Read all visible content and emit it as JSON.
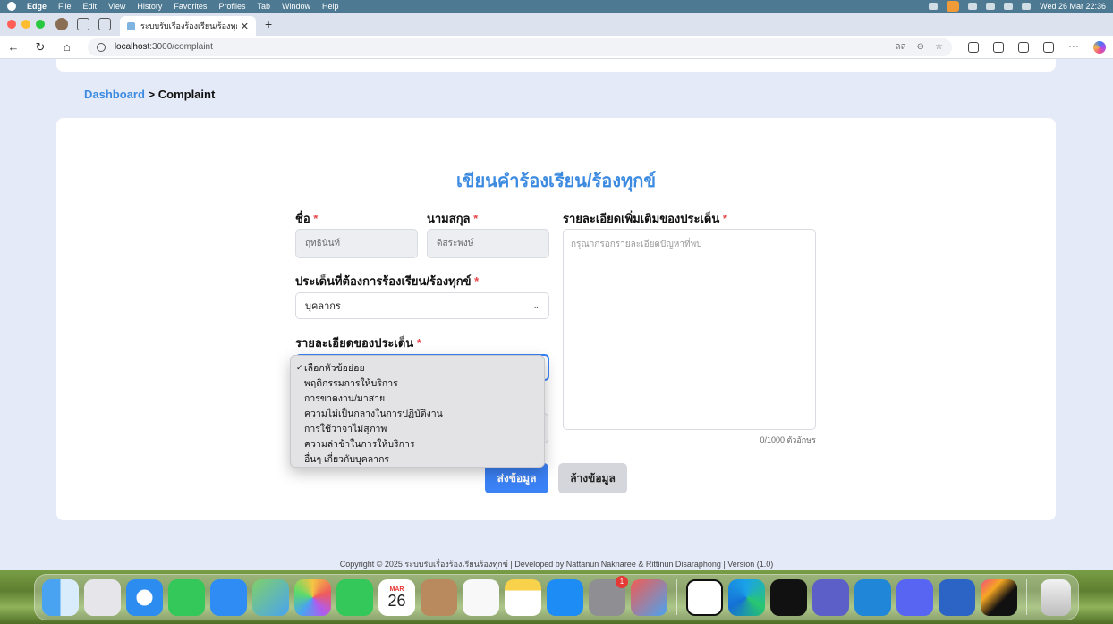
{
  "menubar": {
    "app": "Edge",
    "items": [
      "File",
      "Edit",
      "View",
      "History",
      "Favorites",
      "Profiles",
      "Tab",
      "Window",
      "Help"
    ],
    "clock": "Wed 26 Mar  22:36"
  },
  "browser": {
    "tab_title": "ระบบรับเรื่องร้องเรียน/ร้องทุกข์คณะ",
    "url_host": "localhost",
    "url_path": ":3000/complaint",
    "url_right": "ลล"
  },
  "breadcrumb": {
    "root": "Dashboard",
    "sep": " > ",
    "current": "Complaint"
  },
  "form": {
    "title": "เขียนคำร้องเรียน/ร้องทุกข์",
    "required_mark": "*",
    "first_name_label": "ชื่อ",
    "first_name_value": "ฤทธินันท์",
    "last_name_label": "นามสกุล",
    "last_name_value": "ดิสระพงษ์",
    "detail_label": "รายละเอียดเพิ่มเติมของประเด็น",
    "detail_placeholder": "กรุณากรอกรายละเอียดปัญหาที่พบ",
    "detail_counter": "0/1000 ตัวอักษร",
    "issue_label": "ประเด็นที่ต้องการร้องเรียน/ร้องทุกข์",
    "issue_value": "บุคลากร",
    "subissue_label": "รายละเอียดของประเด็น",
    "submit_label": "ส่งข้อมูล",
    "clear_label": "ล้างข้อมูล"
  },
  "dropdown": {
    "checkmark": "✓",
    "options": [
      "เลือกหัวข้อย่อย",
      "พฤติกรรมการให้บริการ",
      "การขาดงาน/มาสาย",
      "ความไม่เป็นกลางในการปฏิบัติงาน",
      "การใช้วาจาไม่สุภาพ",
      "ความล่าช้าในการให้บริการ",
      "อื่นๆ เกี่ยวกับบุคลากร"
    ]
  },
  "footer": {
    "text": "Copyright © 2025 ระบบรับเรื่องร้องเรียนร้องทุกข์ | Developed by Nattanun Naknaree & Rittinun Disaraphong | Version (1.0)"
  },
  "dock": {
    "calendar_month": "MAR",
    "calendar_day": "26",
    "settings_badge": "1"
  },
  "colors": {
    "accent": "#3d8be0",
    "primary_button": "#3b82f6",
    "required": "#e5484d"
  }
}
